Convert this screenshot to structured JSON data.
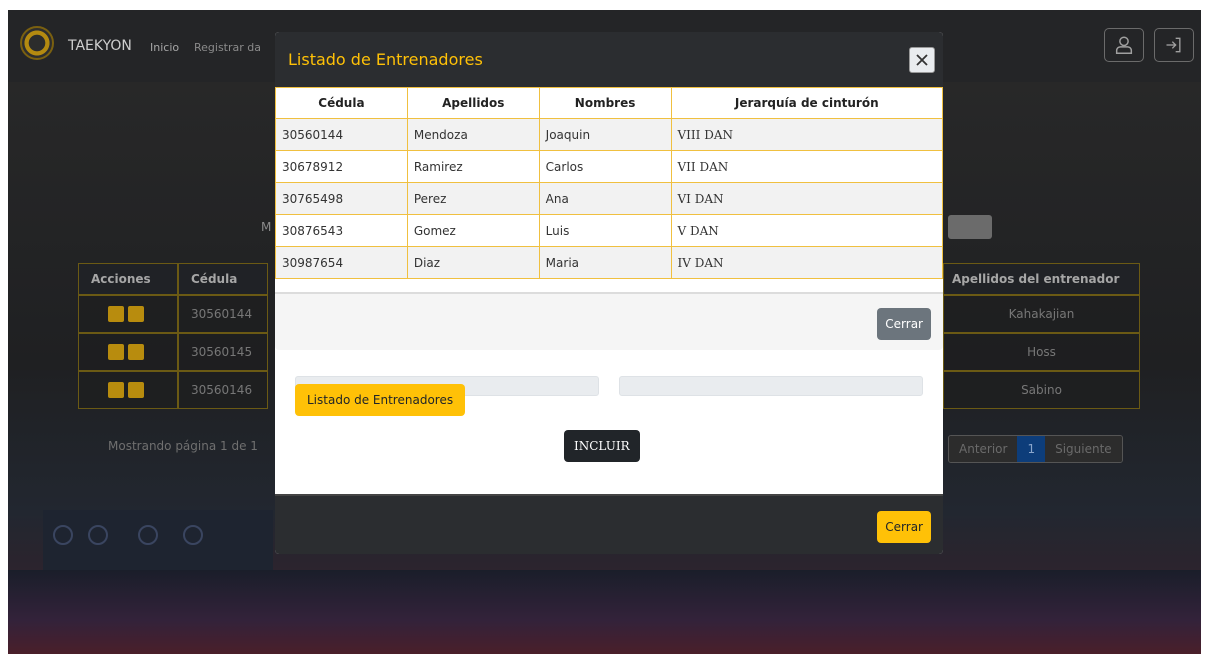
{
  "navbar": {
    "brand": "TAEKYON",
    "links": [
      "Inicio",
      "Registrar da"
    ],
    "icons": [
      "user-icon",
      "logout-icon"
    ]
  },
  "background": {
    "label_m": "M",
    "table": {
      "headers": [
        "Acciones",
        "Cédula",
        "Apellidos del entrenador"
      ],
      "rows": [
        {
          "cedula": "30560144",
          "apellido": "Kahakajian"
        },
        {
          "cedula": "30560145",
          "apellido": "Hoss"
        },
        {
          "cedula": "30560146",
          "apellido": "Sabino"
        }
      ]
    },
    "footer_text": "Mostrando página 1 de 1",
    "pager": {
      "prev": "Anterior",
      "current": "1",
      "next": "Siguiente"
    }
  },
  "back_modal": {
    "listado_button": "Listado de Entrenadores",
    "incluir_button": "INCLUIR",
    "cerrar_button": "Cerrar"
  },
  "front_modal": {
    "title": "Listado de Entrenadores",
    "columns": [
      "Cédula",
      "Apellidos",
      "Nombres",
      "Jerarquía de cinturón"
    ],
    "rows": [
      [
        "30560144",
        "Mendoza",
        "Joaquin",
        "VIII DAN"
      ],
      [
        "30678912",
        "Ramirez",
        "Carlos",
        "VII DAN"
      ],
      [
        "30765498",
        "Perez",
        "Ana",
        "VI DAN"
      ],
      [
        "30876543",
        "Gomez",
        "Luis",
        "V DAN"
      ],
      [
        "30987654",
        "Diaz",
        "Maria",
        "IV DAN"
      ]
    ],
    "cerrar_button": "Cerrar"
  },
  "colors": {
    "accent": "#ffc107",
    "dark": "#2b2d30",
    "secondary": "#6c757d",
    "table_border": "#f0c040"
  }
}
